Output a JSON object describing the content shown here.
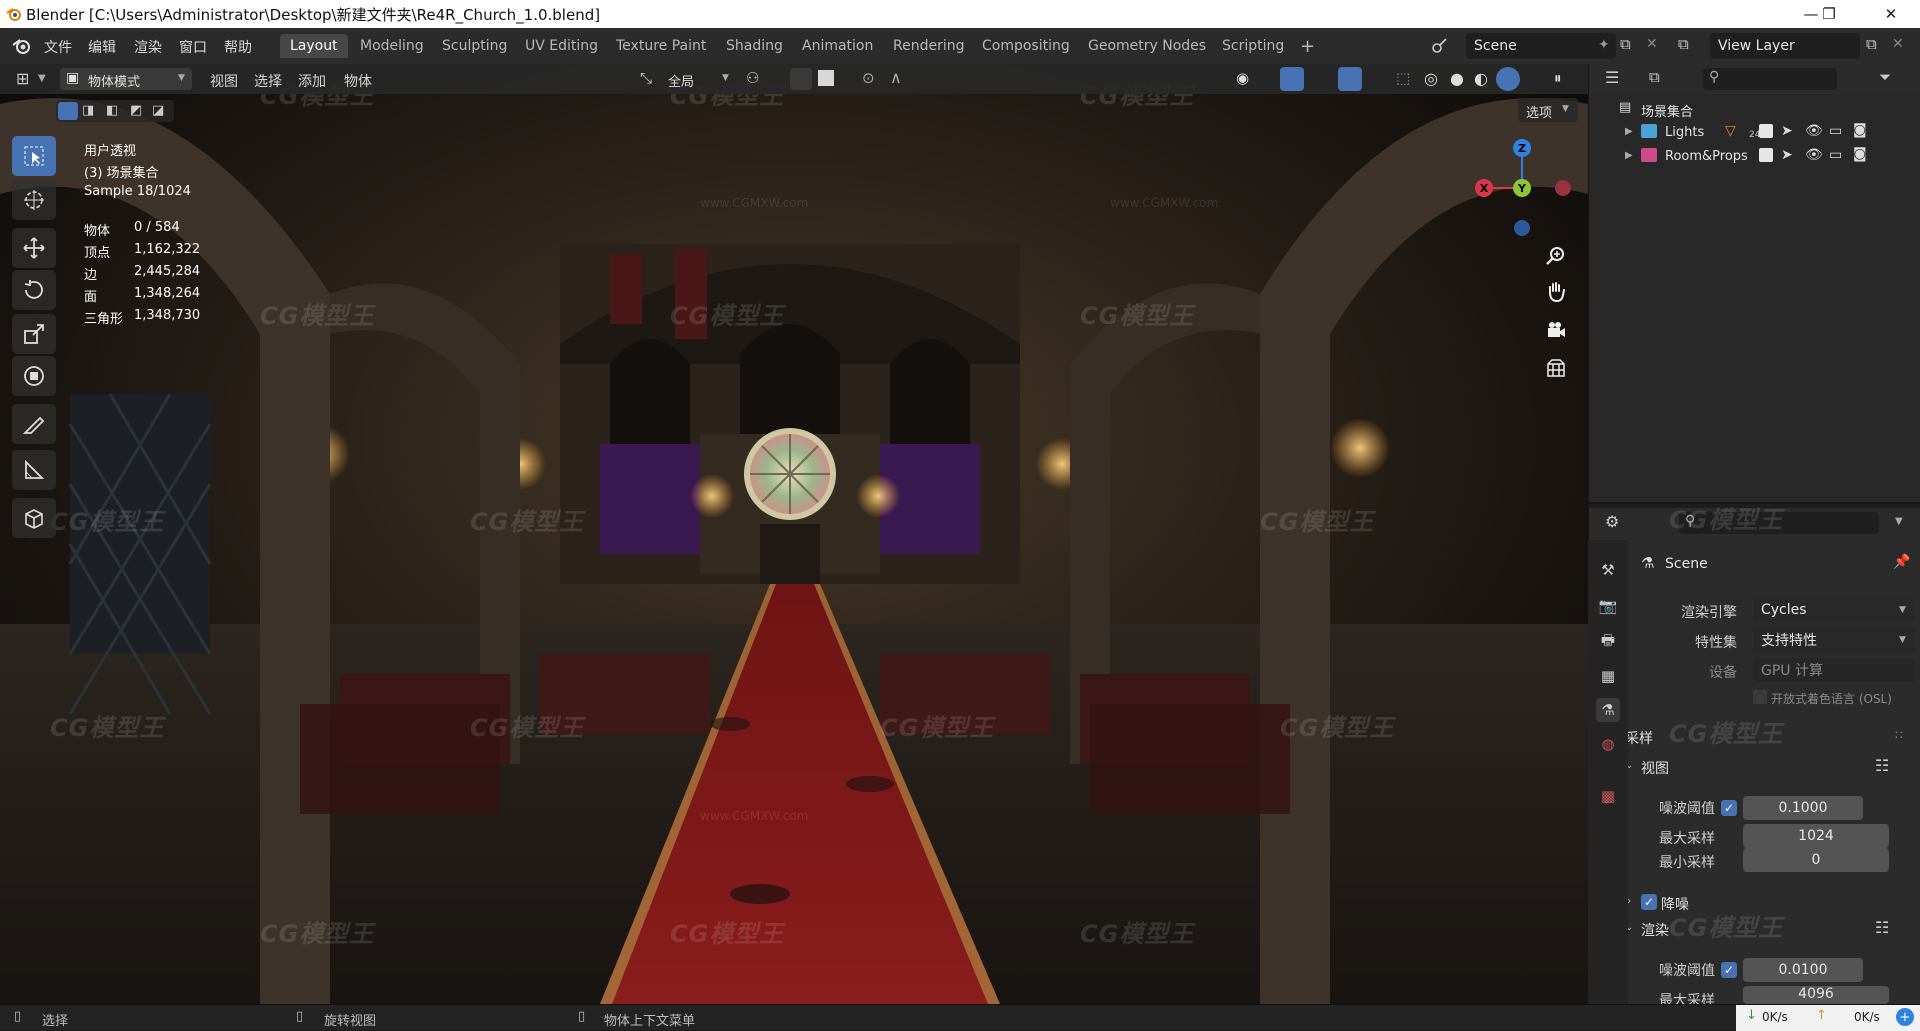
{
  "window": {
    "title": "Blender [C:\\Users\\Administrator\\Desktop\\新建文件夹\\Re4R_Church_1.0.blend]",
    "minimize": "—",
    "maximize": "❐",
    "close": "✕"
  },
  "menu": [
    "文件",
    "编辑",
    "渲染",
    "窗口",
    "帮助"
  ],
  "workspaces": [
    "Layout",
    "Modeling",
    "Sculpting",
    "UV Editing",
    "Texture Paint",
    "Shading",
    "Animation",
    "Rendering",
    "Compositing",
    "Geometry Nodes",
    "Scripting"
  ],
  "workspace_add": "+",
  "scene_field": "Scene",
  "view_layer_field": "View Layer",
  "viewport_header": {
    "mode": "物体模式",
    "menus": [
      "视图",
      "选择",
      "添加",
      "物体"
    ],
    "transform_orientation": "全局",
    "options": "选项"
  },
  "overlay": {
    "view_name": "用户透视",
    "collection": "(3) 场景集合",
    "sample": "Sample 18/1024",
    "stats": [
      {
        "label": "物体",
        "value": "0 / 584"
      },
      {
        "label": "顶点",
        "value": "1,162,322"
      },
      {
        "label": "边",
        "value": "2,445,284"
      },
      {
        "label": "面",
        "value": "1,348,264"
      },
      {
        "label": "三角形",
        "value": "1,348,730"
      }
    ]
  },
  "gizmo": {
    "x": "X",
    "y": "Y",
    "z": "Z"
  },
  "outliner": {
    "root": "场景集合",
    "items": [
      {
        "name": "Lights",
        "badge": "24"
      },
      {
        "name": "Room&Props",
        "badge": ""
      }
    ]
  },
  "properties": {
    "context": "Scene",
    "render_engine_label": "渲染引擎",
    "render_engine": "Cycles",
    "feature_set_label": "特性集",
    "feature_set": "支持特性",
    "device_label": "设备",
    "device": "GPU 计算",
    "osl_label": "开放式着色语言 (OSL)",
    "sampling": "采样",
    "viewport": "视图",
    "noise_threshold_label": "噪波阈值",
    "viewport_noise_threshold": "0.1000",
    "max_samples_label": "最大采样",
    "viewport_max_samples": "1024",
    "min_samples_label": "最小采样",
    "viewport_min_samples": "0",
    "denoise": "降噪",
    "render": "渲染",
    "render_noise_threshold": "0.0100",
    "render_max_samples_partial": "4096"
  },
  "statusbar": {
    "select": "选择",
    "rotate": "旋转视图",
    "context_menu": "物体上下文菜单",
    "down_speed": "0K/s",
    "up_speed": "0K/s"
  },
  "watermark": {
    "logo": "CG模型王",
    "url": "www.CGMXW.com"
  },
  "colors": {
    "accent": "#4772b3",
    "x_axis": "#d8374b",
    "y_axis": "#8ac733",
    "z_axis": "#2f83e0",
    "carpet": "#8a1c1c"
  }
}
